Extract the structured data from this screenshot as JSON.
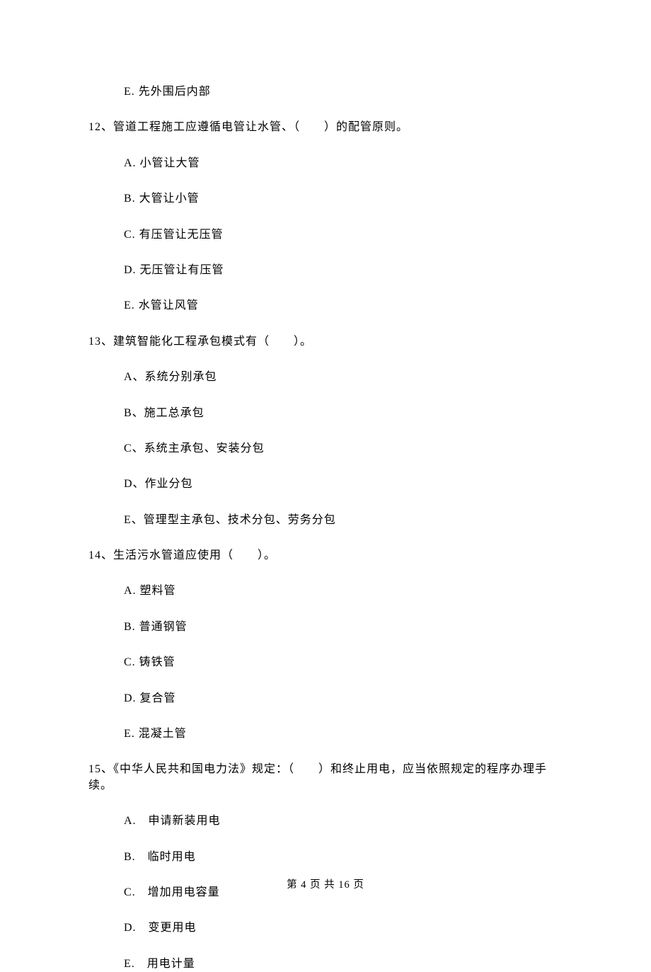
{
  "orphan": {
    "e": "E. 先外围后内部"
  },
  "q12": {
    "text": "12、管道工程施工应遵循电管让水管、（　　）的配管原则。",
    "a": "A. 小管让大管",
    "b": "B. 大管让小管",
    "c": "C. 有压管让无压管",
    "d": "D. 无压管让有压管",
    "e": "E. 水管让风管"
  },
  "q13": {
    "text": "13、建筑智能化工程承包模式有（　　）。",
    "a": "A、系统分别承包",
    "b": "B、施工总承包",
    "c": "C、系统主承包、安装分包",
    "d": "D、作业分包",
    "e": "E、管理型主承包、技术分包、劳务分包"
  },
  "q14": {
    "text": "14、生活污水管道应使用（　　）。",
    "a": "A. 塑料管",
    "b": "B. 普通钢管",
    "c": "C. 铸铁管",
    "d": "D. 复合管",
    "e": "E. 混凝土管"
  },
  "q15": {
    "text": "15、《中华人民共和国电力法》规定：（　　）和终止用电，应当依照规定的程序办理手续。",
    "a": "A.　申请新装用电",
    "b": "B.　临时用电",
    "c": "C.　增加用电容量",
    "d": "D.　变更用电",
    "e": "E.　用电计量"
  },
  "footer": "第 4 页 共 16 页"
}
